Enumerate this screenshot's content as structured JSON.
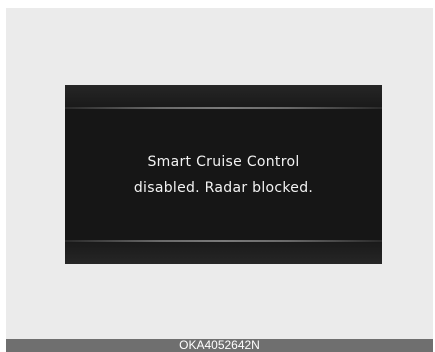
{
  "display": {
    "line1": "Smart Cruise Control",
    "line2": "disabled. Radar blocked."
  },
  "caption": {
    "code": "OKA4052642N"
  }
}
